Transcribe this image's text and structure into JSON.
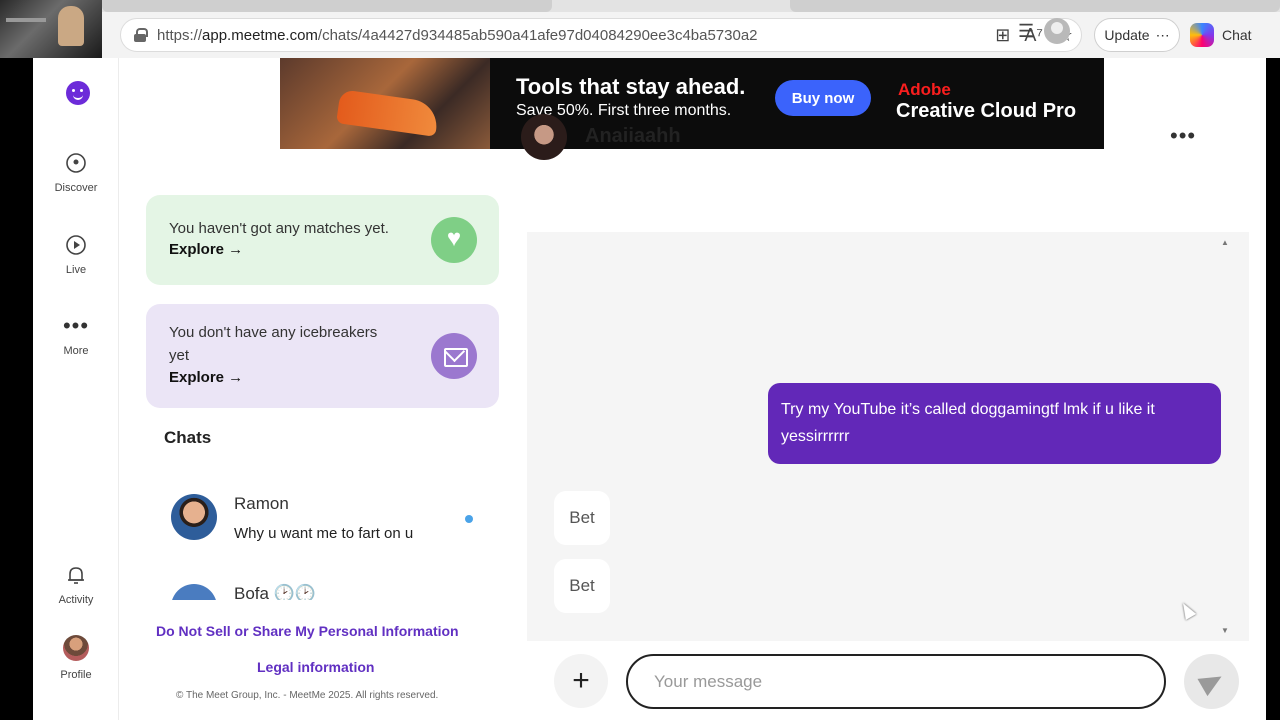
{
  "browser": {
    "url_prefix": "https://",
    "url_host": "app.meetme.com",
    "url_path": "/chats/4a4427d934485ab590a41afe97d04084290ee3c4ba5730a2",
    "update_label": "Update",
    "update_more": "⋯",
    "chat_label": "Chat"
  },
  "nav": {
    "discover": "Discover",
    "live": "Live",
    "more": "More",
    "more_icon": "•••",
    "activity": "Activity",
    "profile": "Profile"
  },
  "ad": {
    "title": "Tools that stay ahead.",
    "subtitle": "Save 50%. First three months.",
    "button": "Buy now",
    "brand": "Adobe",
    "product": "Creative Cloud Pro"
  },
  "cards": {
    "matches_text": "You haven't got any matches yet.",
    "matches_link": "Explore →",
    "icebreakers_line1": "You don't have any icebreakers",
    "icebreakers_line2": "yet",
    "icebreakers_link": "Explore →"
  },
  "chats": {
    "title": "Chats",
    "items": [
      {
        "name": "Ramon",
        "preview": "Why u want me to fart on u",
        "unread": true
      },
      {
        "name": "Bofa 🕑🕑",
        "preview": "",
        "unread": false
      }
    ]
  },
  "footer": {
    "privacy": "Do Not Sell or Share My Personal Information",
    "legal": "Legal information",
    "copyright": "© The Meet Group, Inc. - MeetMe 2025. All rights reserved."
  },
  "conversation": {
    "name": "Anaiiaahh",
    "more_icon": "•••",
    "messages": [
      {
        "direction": "out",
        "text": "Try my YouTube it’s called doggamingtf lmk if u like it yessirrrrrr"
      },
      {
        "direction": "in",
        "text": "Bet"
      },
      {
        "direction": "in",
        "text": "Bet"
      }
    ],
    "input_placeholder": "Your message",
    "plus_icon": "+"
  },
  "colors": {
    "brand_purple": "#6228b8",
    "matches_bg": "#e4f5e5",
    "icebreakers_bg": "#ebe5f6",
    "unread_dot": "#4aa3e8"
  }
}
